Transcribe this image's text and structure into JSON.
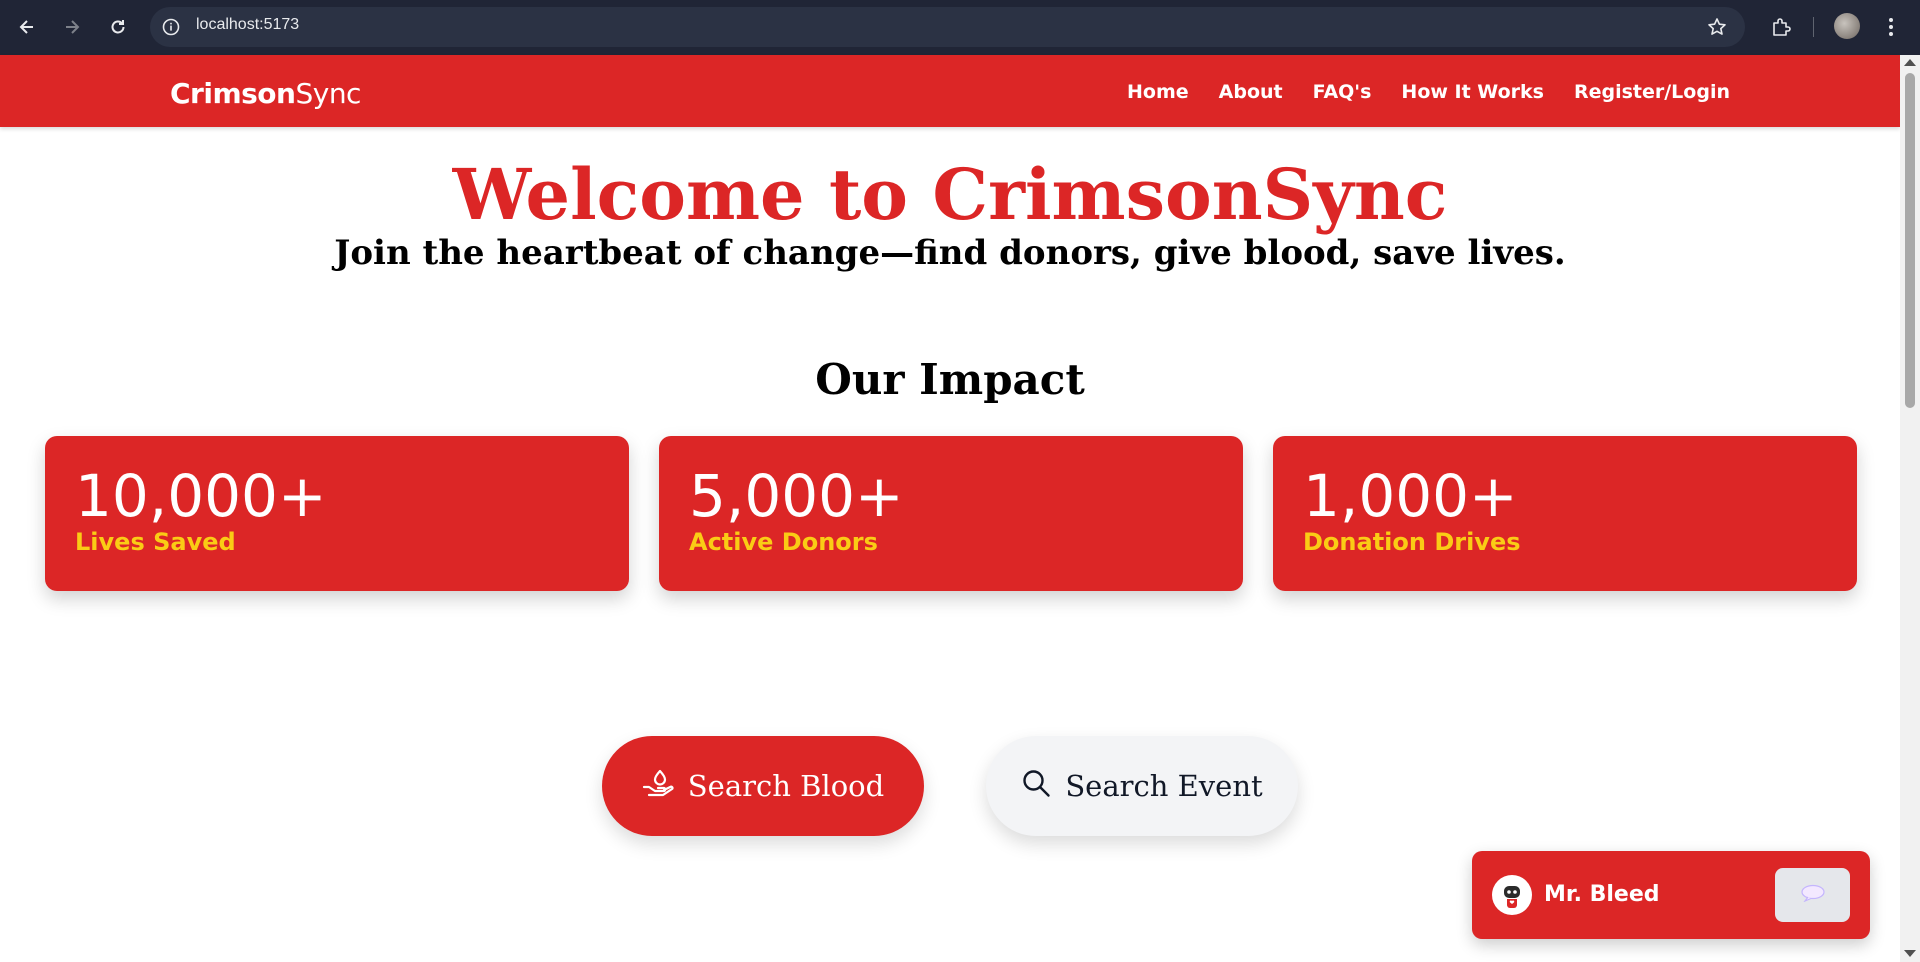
{
  "browser": {
    "url": "localhost:5173",
    "icons": [
      "back-icon",
      "forward-icon",
      "reload-icon",
      "site-info-icon",
      "star-icon",
      "extensions-icon",
      "menu-icon"
    ]
  },
  "navbar": {
    "brand_bold": "Crimson",
    "brand_light": "Sync",
    "links": [
      "Home",
      "About",
      "FAQ's",
      "How It Works",
      "Register/Login"
    ]
  },
  "hero": {
    "title": "Welcome to CrimsonSync",
    "subtitle": "Join the heartbeat of change—find donors, give blood, save lives."
  },
  "impact": {
    "title": "Our Impact",
    "stats": [
      {
        "value": "10,000+",
        "label": "Lives Saved"
      },
      {
        "value": "5,000+",
        "label": "Active Donors"
      },
      {
        "value": "1,000+",
        "label": "Donation Drives"
      }
    ]
  },
  "actions": {
    "search_blood": "Search Blood",
    "search_event": "Search Event"
  },
  "chat": {
    "name": "Mr. Bleed"
  },
  "colors": {
    "brand_red": "#dc2626",
    "stat_label_yellow": "#facc15",
    "secondary_button": "#f3f4f6"
  }
}
